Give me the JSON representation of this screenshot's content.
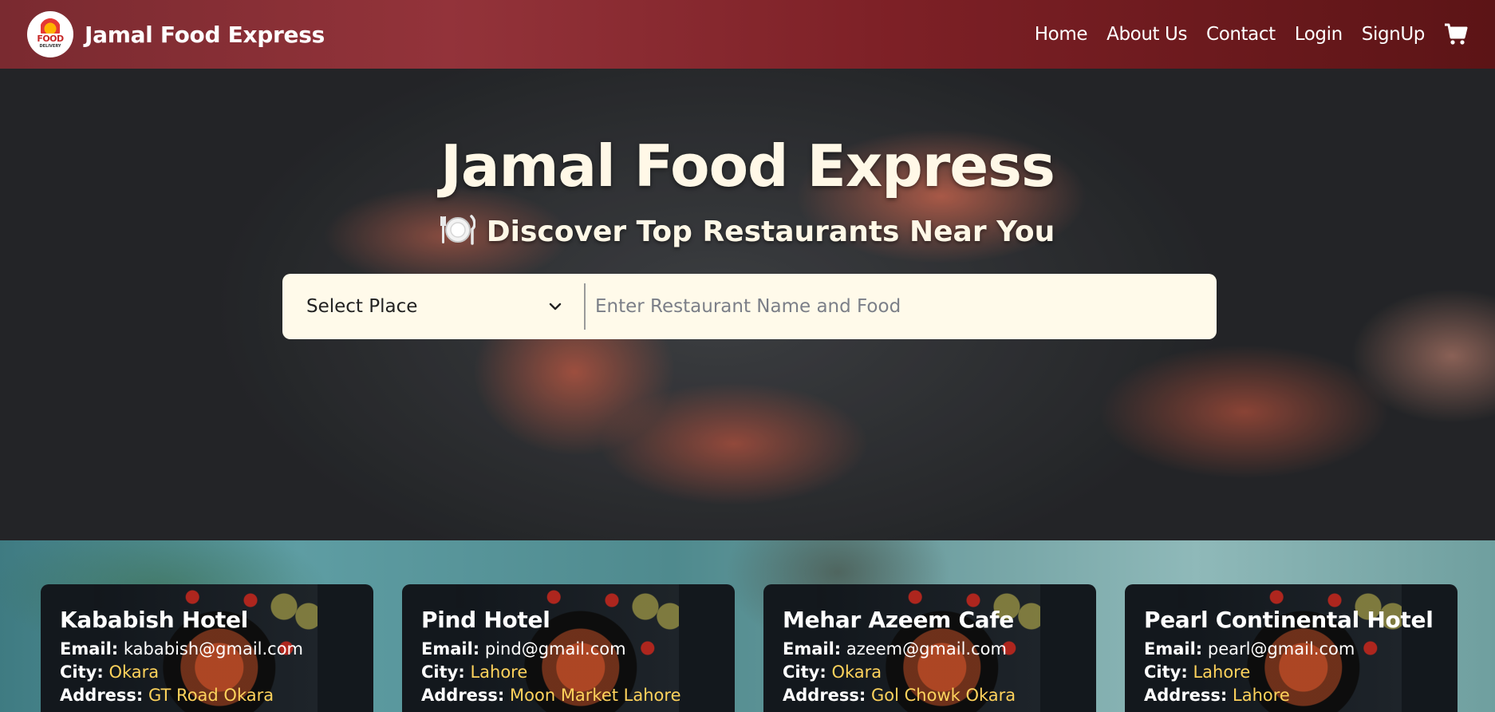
{
  "navbar": {
    "logo_text": "FOOD",
    "logo_subtext": "DELIVERY",
    "brand": "Jamal Food Express",
    "links": [
      "Home",
      "About Us",
      "Contact",
      "Login",
      "SignUp"
    ],
    "cart_icon": "cart-icon"
  },
  "hero": {
    "title": "Jamal Food Express",
    "subtitle": "Discover Top Restaurants Near You",
    "subtitle_icon": "plate-cutlery-icon",
    "select_value": "Select Place",
    "search_placeholder": "Enter Restaurant Name and Food"
  },
  "labels": {
    "email": "Email:",
    "city": "City:",
    "address": "Address:"
  },
  "restaurants": [
    {
      "name": "Kababish Hotel",
      "email": "kababish@gmail.com",
      "city": "Okara",
      "address": "GT Road Okara"
    },
    {
      "name": "Pind Hotel",
      "email": "pind@gmail.com",
      "city": "Lahore",
      "address": "Moon Market Lahore"
    },
    {
      "name": "Mehar Azeem Cafe",
      "email": "azeem@gmail.com",
      "city": "Okara",
      "address": "Gol Chowk Okara"
    },
    {
      "name": "Pearl Continental Hotel",
      "email": "pearl@gmail.com",
      "city": "Lahore",
      "address": "Lahore"
    }
  ],
  "colors": {
    "navbar": "#7d2026",
    "accent_yellow": "#ffd35c",
    "search_bg": "#fffaea",
    "hero_text": "#fff8e7"
  }
}
